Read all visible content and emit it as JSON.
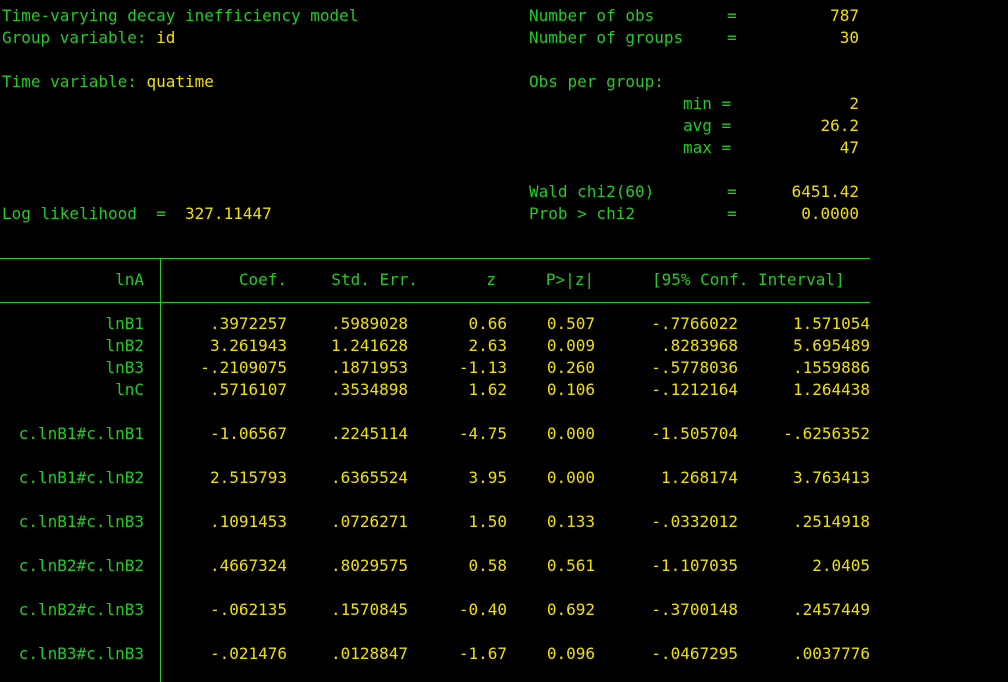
{
  "header": {
    "model_title": "Time-varying decay inefficiency model",
    "group_label": "Group variable:",
    "group_value": "id",
    "time_label": "Time variable:",
    "time_value": "quatime",
    "loglik_label": "Log likelihood  =",
    "loglik_value": "327.11447",
    "stats": {
      "nobs_label": "Number of obs",
      "nobs_eq": "=",
      "nobs_value": "787",
      "ngroups_label": "Number of groups",
      "ngroups_eq": "=",
      "ngroups_value": "30",
      "obs_per_group_label": "Obs per group:",
      "min_label": "min =",
      "min_value": "2",
      "avg_label": "avg =",
      "avg_value": "26.2",
      "max_label": "max =",
      "max_value": "47",
      "wald_label": "Wald chi2(60)",
      "wald_eq": "=",
      "wald_value": "6451.42",
      "prob_label": "Prob > chi2",
      "prob_eq": "=",
      "prob_value": "0.0000"
    }
  },
  "table": {
    "depvar": "lnA",
    "columns": [
      "Coef.",
      "Std. Err.",
      "z",
      "P>|z|",
      "[95% Conf. Interval]"
    ],
    "rows": [
      {
        "name": "lnB1",
        "coef": ".3972257",
        "se": ".5989028",
        "z": "0.66",
        "p": "0.507",
        "lo": "-.7766022",
        "hi": "1.571054"
      },
      {
        "name": "lnB2",
        "coef": "3.261943",
        "se": "1.241628",
        "z": "2.63",
        "p": "0.009",
        "lo": ".8283968",
        "hi": "5.695489"
      },
      {
        "name": "lnB3",
        "coef": "-.2109075",
        "se": ".1871953",
        "z": "-1.13",
        "p": "0.260",
        "lo": "-.5778036",
        "hi": ".1559886"
      },
      {
        "name": "lnC",
        "coef": ".5716107",
        "se": ".3534898",
        "z": "1.62",
        "p": "0.106",
        "lo": "-.1212164",
        "hi": "1.264438"
      },
      {
        "name": "c.lnB1#c.lnB1",
        "coef": "-1.06567",
        "se": ".2245114",
        "z": "-4.75",
        "p": "0.000",
        "lo": "-1.505704",
        "hi": "-.6256352"
      },
      {
        "name": "c.lnB1#c.lnB2",
        "coef": "2.515793",
        "se": ".6365524",
        "z": "3.95",
        "p": "0.000",
        "lo": "1.268174",
        "hi": "3.763413"
      },
      {
        "name": "c.lnB1#c.lnB3",
        "coef": ".1091453",
        "se": ".0726271",
        "z": "1.50",
        "p": "0.133",
        "lo": "-.0332012",
        "hi": ".2514918"
      },
      {
        "name": "c.lnB2#c.lnB2",
        "coef": ".4667324",
        "se": ".8029575",
        "z": "0.58",
        "p": "0.561",
        "lo": "-1.107035",
        "hi": "2.0405"
      },
      {
        "name": "c.lnB2#c.lnB3",
        "coef": "-.062135",
        "se": ".1570845",
        "z": "-0.40",
        "p": "0.692",
        "lo": "-.3700148",
        "hi": ".2457449"
      },
      {
        "name": "c.lnB3#c.lnB3",
        "coef": "-.021476",
        "se": ".0128847",
        "z": "-1.67",
        "p": "0.096",
        "lo": "-.0467295",
        "hi": ".0037776"
      }
    ]
  }
}
